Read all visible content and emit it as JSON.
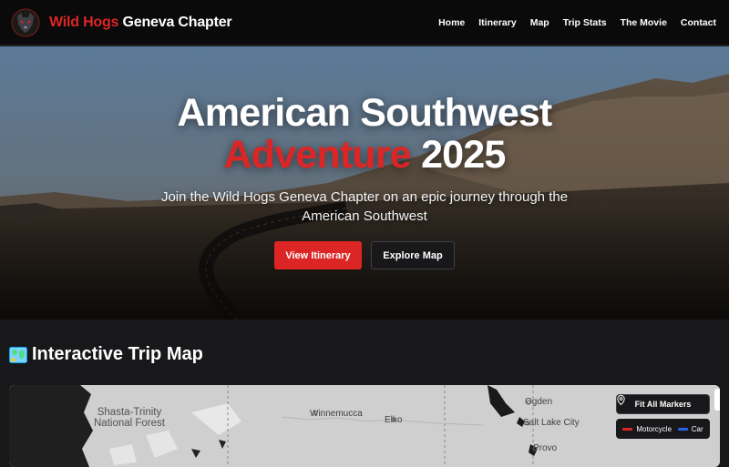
{
  "header": {
    "brand_accent": "Wild Hogs",
    "brand_rest": " Geneva Chapter",
    "logo_icon": "wolf-emblem-icon",
    "nav": [
      {
        "label": "Home"
      },
      {
        "label": "Itinerary"
      },
      {
        "label": "Map"
      },
      {
        "label": "Trip Stats"
      },
      {
        "label": "The Movie"
      },
      {
        "label": "Contact"
      }
    ]
  },
  "hero": {
    "title_line1": "American Southwest",
    "title_accent": "Adventure",
    "title_year": " 2025",
    "subtitle": "Join the Wild Hogs Geneva Chapter on an epic journey through the American Southwest",
    "primary_button": "View Itinerary",
    "secondary_button": "Explore Map"
  },
  "map_section": {
    "title": "Interactive Trip Map",
    "title_icon": "world-map-icon",
    "fit_button": "Fit All Markers",
    "fit_icon": "location-pin-icon",
    "legend": [
      {
        "label": "Motorcycle",
        "color": "#dc2626"
      },
      {
        "label": "Car",
        "color": "#2563eb"
      }
    ],
    "places": {
      "forest": "Shasta-Trinity\nNational Forest",
      "winnemucca": "Winnemucca",
      "elko": "Elko",
      "ogden": "Ogden",
      "slc": "Salt Lake City",
      "provo": "Provo"
    }
  },
  "colors": {
    "accent": "#dc2626",
    "background": "#18181b"
  }
}
